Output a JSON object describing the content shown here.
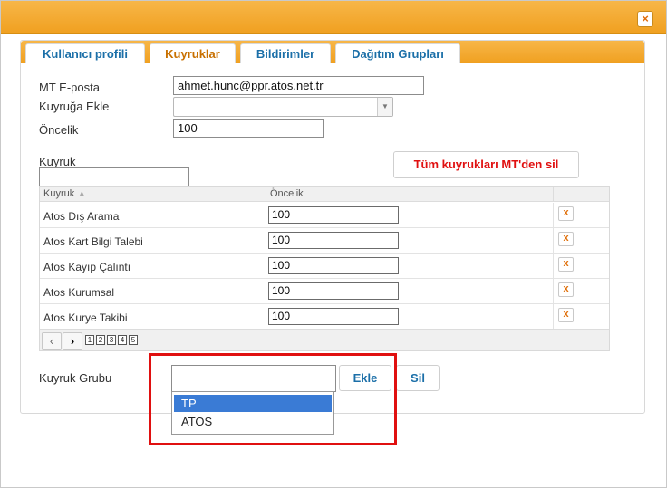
{
  "dialog": {
    "close_label": "×"
  },
  "tabs": [
    {
      "label": "Kullanıcı profili"
    },
    {
      "label": "Kuyruklar"
    },
    {
      "label": "Bildirimler"
    },
    {
      "label": "Dağıtım Grupları"
    }
  ],
  "form": {
    "email_label": "MT E-posta",
    "email_value": "ahmet.hunc@ppr.atos.net.tr",
    "add_queue_label": "Kuyruğa Ekle",
    "add_queue_value": "",
    "priority_label": "Öncelik",
    "priority_value": "100"
  },
  "queue_filter": {
    "label": "Kuyruk",
    "value": ""
  },
  "delete_all_button": "Tüm kuyrukları MT'den sil",
  "grid": {
    "col_queue": "Kuyruk",
    "col_queue_sort": "▲",
    "col_priority": "Öncelik",
    "rows": [
      {
        "name": "Atos Dış Arama",
        "priority": "100"
      },
      {
        "name": "Atos Kart Bilgi Talebi",
        "priority": "100"
      },
      {
        "name": "Atos Kayıp Çalıntı",
        "priority": "100"
      },
      {
        "name": "Atos Kurumsal",
        "priority": "100"
      },
      {
        "name": "Atos Kurye Takibi",
        "priority": "100"
      }
    ],
    "pages": [
      "1",
      "2",
      "3",
      "4",
      "5"
    ]
  },
  "queue_group": {
    "label": "Kuyruk Grubu",
    "value": "",
    "add_button": "Ekle",
    "delete_button": "Sil",
    "options": [
      {
        "label": "TP",
        "selected": true
      },
      {
        "label": "ATOS",
        "selected": false
      }
    ]
  },
  "icons": {
    "delete": "close-x-icon",
    "prev": "chevron-left-icon",
    "next": "chevron-right-icon",
    "sort": "sort-up-icon"
  },
  "colors": {
    "accent_orange": "#f0a020",
    "link_blue": "#1b6fa8",
    "danger_red": "#e01010",
    "selection_blue": "#3a7bd5"
  }
}
